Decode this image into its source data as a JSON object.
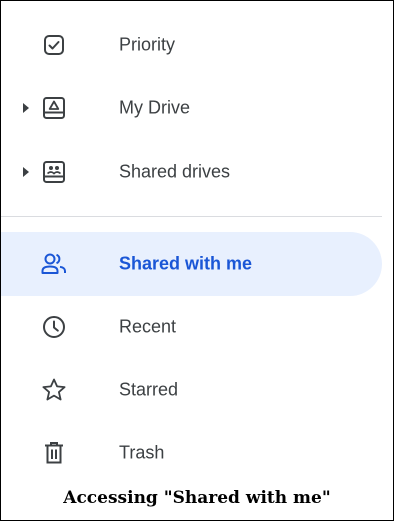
{
  "nav": {
    "items": [
      {
        "label": "Priority",
        "icon": "checkbox-icon"
      },
      {
        "label": "My Drive",
        "icon": "drive-icon",
        "expandable": true
      },
      {
        "label": "Shared drives",
        "icon": "shared-drives-icon",
        "expandable": true
      },
      {
        "label": "Shared with me",
        "icon": "people-icon",
        "active": true
      },
      {
        "label": "Recent",
        "icon": "clock-icon"
      },
      {
        "label": "Starred",
        "icon": "star-icon"
      },
      {
        "label": "Trash",
        "icon": "trash-icon"
      }
    ]
  },
  "caption": "Accessing \"Shared with me\"",
  "colors": {
    "active_background": "#e8f0fe",
    "active_text": "#1a56d6",
    "text": "#3c4043",
    "icon": "#3c4043",
    "divider": "#dadce0"
  }
}
